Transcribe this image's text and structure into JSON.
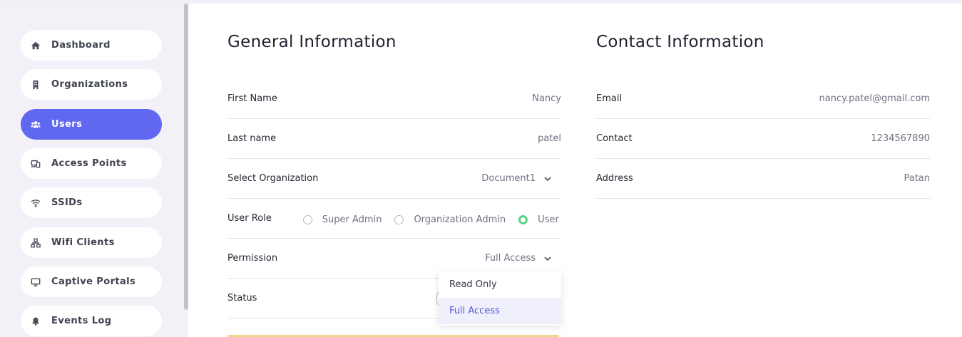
{
  "sidebar": {
    "items": [
      {
        "label": "Dashboard",
        "icon": "home-icon"
      },
      {
        "label": "Organizations",
        "icon": "building-icon"
      },
      {
        "label": "Users",
        "icon": "users-icon",
        "active": true
      },
      {
        "label": "Access Points",
        "icon": "devices-icon"
      },
      {
        "label": "SSIDs",
        "icon": "wifi-icon"
      },
      {
        "label": "Wifi Clients",
        "icon": "network-icon"
      },
      {
        "label": "Captive Portals",
        "icon": "monitor-icon"
      },
      {
        "label": "Events Log",
        "icon": "bell-icon"
      }
    ]
  },
  "general": {
    "title": "General Information",
    "first_name_label": "First Name",
    "first_name_value": "Nancy",
    "last_name_label": "Last name",
    "last_name_value": "patel",
    "organization_label": "Select Organization",
    "organization_value": "Document1",
    "role_label": "User Role",
    "roles": [
      "Super Admin",
      "Organization Admin",
      "User"
    ],
    "selected_role": "User",
    "permission_label": "Permission",
    "permission_value": "Full Access",
    "permission_options": [
      "Read Only",
      "Full Access"
    ],
    "status_label": "Status"
  },
  "contact": {
    "title": "Contact Information",
    "email_label": "Email",
    "email_value": "nancy.patel@gmail.com",
    "contact_label": "Contact",
    "contact_value": "1234567890",
    "address_label": "Address",
    "address_value": "Patan"
  },
  "colors": {
    "accent": "#6067f0",
    "radio_selected": "#5fcf86",
    "sidebar_bg": "#f2f1f7"
  }
}
